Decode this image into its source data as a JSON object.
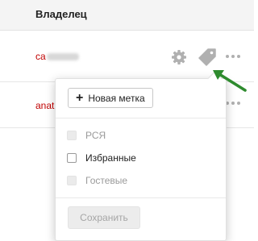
{
  "table": {
    "owner_header": "Владелец",
    "rows": [
      {
        "owner_prefix": "ca"
      },
      {
        "owner_prefix": "anat"
      }
    ]
  },
  "popup": {
    "new_tag_label": "Новая метка",
    "options": [
      {
        "label": "РСЯ",
        "checked": false,
        "enabled": false
      },
      {
        "label": "Избранные",
        "checked": false,
        "enabled": true
      },
      {
        "label": "Гостевые",
        "checked": false,
        "enabled": false
      }
    ],
    "save_label": "Сохранить"
  },
  "icons": {
    "settings": "gear-icon",
    "tag": "tag-icon",
    "more": "more-icon",
    "annotation": "arrow-icon",
    "plus": "plus-icon"
  },
  "colors": {
    "header_bg": "#f4f4f4",
    "owner_text": "#c00000",
    "arrow": "#2e8b2e",
    "icon_gray": "#b0b0b0"
  }
}
